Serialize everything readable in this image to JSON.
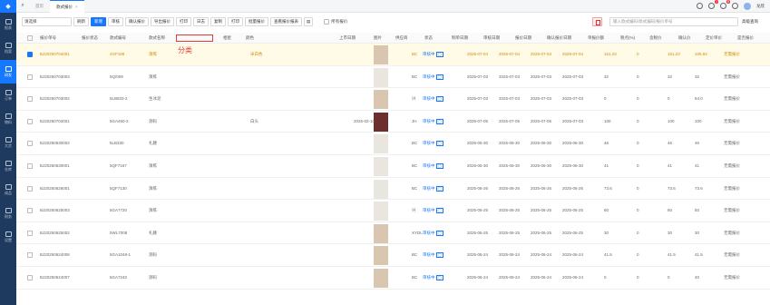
{
  "sidebar": {
    "items": [
      {
        "label": "报表"
      },
      {
        "label": "档案"
      },
      {
        "label": "研发"
      },
      {
        "label": "订单"
      },
      {
        "label": "物料"
      },
      {
        "label": "大货"
      },
      {
        "label": "仓库"
      },
      {
        "label": "成品"
      },
      {
        "label": "财务"
      },
      {
        "label": "设置"
      }
    ]
  },
  "topbar": {
    "tabs": [
      {
        "label": "首页"
      },
      {
        "label": "款式报价"
      }
    ],
    "close": "×",
    "user": "龙欣",
    "notif_badge": "1",
    "msg_badge": "8"
  },
  "toolbar": {
    "select_value": "请选择",
    "refresh": "刷新",
    "add": "新增",
    "review": "审核",
    "confirm": "确认报价",
    "quote": "导出报价",
    "print": "打印",
    "copy": "日志",
    "dup": "复制",
    "print2": "打印",
    "batch": "批量报价",
    "view": "查看报价报表",
    "show_all": "所有报价"
  },
  "search": {
    "placeholder": "输入款式编码/款式编码/报价单号"
  },
  "adv": "高级查询",
  "annotation": "分类",
  "columns": [
    "报价单号",
    "报价状态",
    "款式编号",
    "款式名称",
    "",
    "相星",
    "颜色",
    "上市日期",
    "图片",
    "供应商",
    "状态",
    "制单日期",
    "审核日期",
    "报价日期",
    "确认报价日期",
    "单报价额",
    "税点(%)",
    "含税价",
    "确认价",
    "定价单价",
    "是否报价"
  ],
  "rows": [
    {
      "no": "BJ20250704001",
      "style": "4GF188",
      "name": "演练",
      "color": "米白色",
      "date": "",
      "sup": "BC",
      "status": "审核中",
      "d1": "2025-07-04",
      "d2": "2025-07-04",
      "d3": "2025-07-04",
      "d4": "2025-07-04",
      "amt": "151.23",
      "tax": "0",
      "price": "151.23",
      "conf": "105.84",
      "flag": "无需报价"
    },
    {
      "no": "BJ20250703003",
      "style": "5Q/009",
      "name": "演练",
      "color": "",
      "date": "",
      "sup": "BC",
      "status": "审核中",
      "d1": "2025-07-03",
      "d2": "2025-07-03",
      "d3": "2025-07-03",
      "d4": "2025-07-03",
      "amt": "32",
      "tax": "0",
      "price": "32",
      "conf": "32",
      "flag": "无需报价"
    },
    {
      "no": "BJ20250703002",
      "style": "5LB833-2",
      "name": "生冰泥",
      "color": "",
      "date": "",
      "sup": "兴",
      "status": "审核中",
      "d1": "2025-07-03",
      "d2": "2025-07-03",
      "d3": "2025-07-03",
      "d4": "2025-07-03",
      "amt": "0",
      "tax": "0",
      "price": "0",
      "conf": "64.0",
      "flag": "无需报价"
    },
    {
      "no": "BJ20250704001",
      "style": "5GA460-2",
      "name": "测码",
      "color": "白头",
      "date": "2025-02-10",
      "sup": "JH",
      "status": "审核中",
      "d1": "2025-07-05",
      "d2": "2025-07-05",
      "d3": "2025-07-05",
      "d4": "2025-07-03",
      "amt": "100",
      "tax": "0",
      "price": "100",
      "conf": "100",
      "flag": "无需报价"
    },
    {
      "no": "BJ20250630002",
      "style": "5LB330",
      "name": "扎腰",
      "color": "",
      "date": "",
      "sup": "BC",
      "status": "审核中",
      "d1": "2025-06-30",
      "d2": "2025-06-30",
      "d3": "2025-06-30",
      "d4": "2025-06-30",
      "amt": "46",
      "tax": "0",
      "price": "46",
      "conf": "46",
      "flag": "无需报价"
    },
    {
      "no": "BJ20250630001",
      "style": "5QF7167",
      "name": "演练",
      "color": "",
      "date": "",
      "sup": "BC",
      "status": "审核中",
      "d1": "2025-06-30",
      "d2": "2025-06-30",
      "d3": "2025-06-30",
      "d4": "2025-06-30",
      "amt": "41",
      "tax": "0",
      "price": "41",
      "conf": "41",
      "flag": "无需报价"
    },
    {
      "no": "BJ20250626001",
      "style": "5QF7130",
      "name": "演练",
      "color": "",
      "date": "",
      "sup": "BC",
      "status": "审核中",
      "d1": "2025-06-26",
      "d2": "2025-06-26",
      "d3": "2025-06-26",
      "d4": "2025-06-26",
      "amt": "73.6",
      "tax": "0",
      "price": "73.6",
      "conf": "73.6",
      "flag": "无需报价"
    },
    {
      "no": "BJ20250625003",
      "style": "5GA7720",
      "name": "演练",
      "color": "",
      "date": "",
      "sup": "兴",
      "status": "审核中",
      "d1": "2025-06-25",
      "d2": "2025-06-25",
      "d3": "2025-06-25",
      "d4": "2025-06-25",
      "amt": "60",
      "tax": "0",
      "price": "60",
      "conf": "60",
      "flag": "无需报价"
    },
    {
      "no": "BJ20250625002",
      "style": "5WL7008",
      "name": "扎腰",
      "color": "",
      "date": "",
      "sup": "XYDL",
      "status": "审核中",
      "d1": "2025-06-25",
      "d2": "2025-06-25",
      "d3": "2025-06-25",
      "d4": "2025-06-25",
      "amt": "30",
      "tax": "0",
      "price": "30",
      "conf": "30",
      "flag": "无需报价"
    },
    {
      "no": "BJ20250624008",
      "style": "5GA1049-1",
      "name": "测码",
      "color": "",
      "date": "",
      "sup": "BC",
      "status": "审核中",
      "d1": "2025-06-24",
      "d2": "2025-06-24",
      "d3": "2025-06-24",
      "d4": "2025-06-24",
      "amt": "41.5",
      "tax": "0",
      "price": "41.5",
      "conf": "41.5",
      "flag": "无需报价"
    },
    {
      "no": "BJ20250624007",
      "style": "5GA7240",
      "name": "测码",
      "color": "",
      "date": "",
      "sup": "BC",
      "status": "审核中",
      "d1": "2025-06-24",
      "d2": "2025-06-24",
      "d3": "2025-06-24",
      "d4": "2025-06-24",
      "amt": "0",
      "tax": "0",
      "price": "0",
      "conf": "40",
      "flag": "无需报价"
    }
  ]
}
